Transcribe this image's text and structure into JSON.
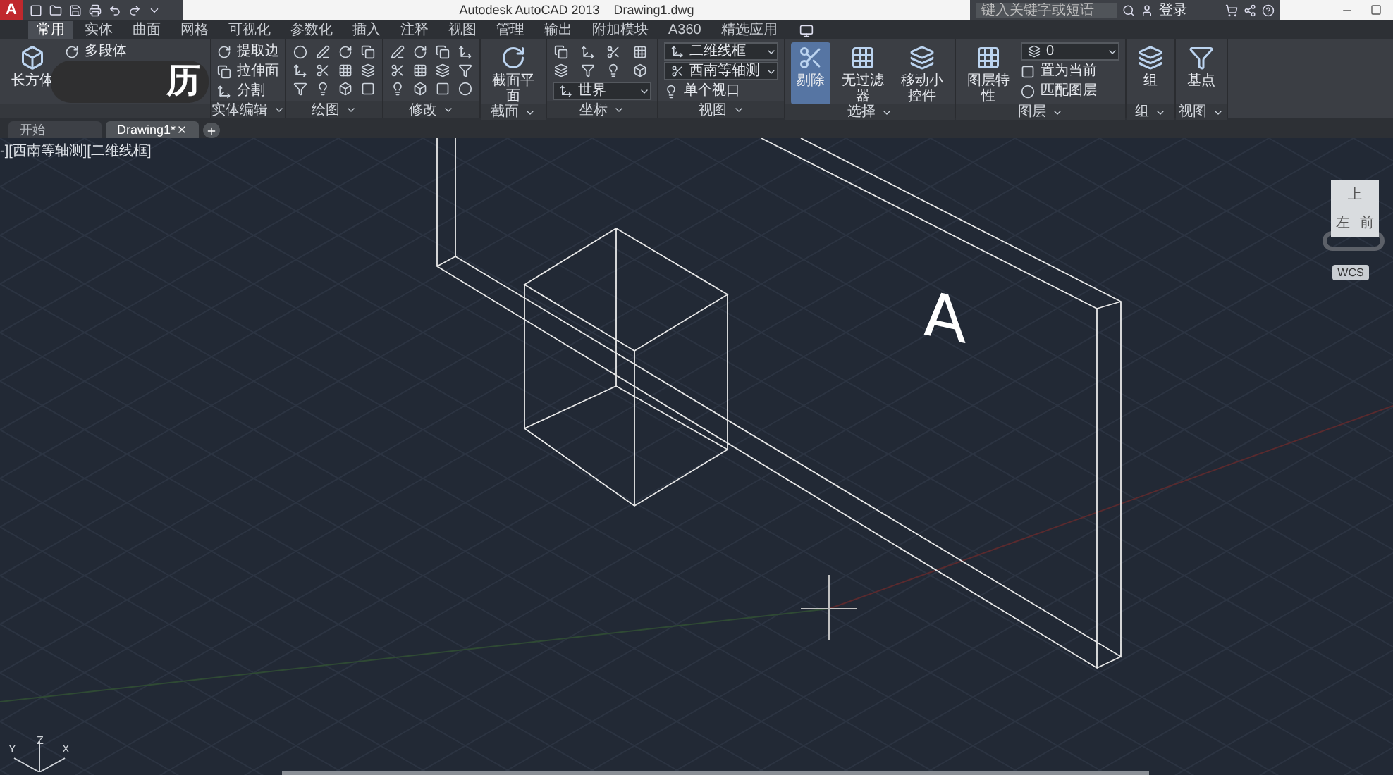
{
  "title_bar": {
    "app_logo": "A",
    "title": "Autodesk AutoCAD 2013    Drawing1.dwg",
    "search": {
      "placeholder": "键入关键字或短语"
    },
    "sign_in": "登录"
  },
  "ribbon_tabs": [
    {
      "label": "常用",
      "selected": true
    },
    {
      "label": "实体",
      "selected": false
    },
    {
      "label": "曲面",
      "selected": false
    },
    {
      "label": "网格",
      "selected": false
    },
    {
      "label": "可视化",
      "selected": false
    },
    {
      "label": "参数化",
      "selected": false
    },
    {
      "label": "插入",
      "selected": false
    },
    {
      "label": "注释",
      "selected": false
    },
    {
      "label": "视图",
      "selected": false
    },
    {
      "label": "管理",
      "selected": false
    },
    {
      "label": "输出",
      "selected": false
    },
    {
      "label": "附加模块",
      "selected": false
    },
    {
      "label": "A360",
      "selected": false
    },
    {
      "label": "精选应用",
      "selected": false
    }
  ],
  "ribbon_panels": [
    {
      "tools": [
        {
          "kind": "large",
          "label": "长方体"
        },
        {
          "kind": "small",
          "label": "多段体"
        }
      ]
    },
    {
      "title": "实体编辑",
      "tools": [
        {
          "kind": "small",
          "label": "提取边"
        },
        {
          "kind": "small",
          "label": "拉伸面"
        },
        {
          "kind": "small",
          "label": "分割"
        }
      ]
    },
    {
      "title": "绘图",
      "tools": [
        {
          "kind": "icon_grid"
        }
      ]
    },
    {
      "title": "修改",
      "tools": [
        {
          "kind": "icon_grid"
        }
      ]
    },
    {
      "title": "截面",
      "tools": [
        {
          "kind": "large",
          "label": "截面平面"
        }
      ]
    },
    {
      "title": "坐标",
      "tools": [
        {
          "kind": "icon_grid"
        },
        {
          "kind": "dropdown",
          "label": "世界"
        }
      ]
    },
    {
      "title": "视图",
      "tools": [
        {
          "kind": "dropdown",
          "label": "二维线框"
        },
        {
          "kind": "dropdown",
          "label": "西南等轴测"
        },
        {
          "kind": "small",
          "label": "单个视口"
        }
      ]
    },
    {
      "title": "选择",
      "tools": [
        {
          "kind": "large",
          "label": "剔除",
          "on": true
        },
        {
          "kind": "large",
          "label": "无过滤器",
          "on": false
        },
        {
          "kind": "large",
          "label": "移动小控件",
          "on": false
        }
      ]
    },
    {
      "title": "图层",
      "tools": [
        {
          "kind": "large",
          "label": "图层特性"
        },
        {
          "kind": "dropdown",
          "label": "0"
        },
        {
          "kind": "small",
          "label": "置为当前"
        },
        {
          "kind": "small",
          "label": "匹配图层"
        }
      ]
    },
    {
      "title": "组",
      "tools": [
        {
          "kind": "large",
          "label": "组"
        }
      ]
    },
    {
      "title": "视图",
      "tools": [
        {
          "kind": "large",
          "label": "基点"
        }
      ]
    }
  ],
  "overlay": {
    "glyph": "历"
  },
  "file_tabs": [
    {
      "label": "开始",
      "selected": false
    },
    {
      "label": "Drawing1*",
      "selected": true
    }
  ],
  "viewport": {
    "label": "-][西南等轴测][二维线框]",
    "model_text": "A",
    "viewcube": {
      "faces": [
        "上",
        "左",
        "前"
      ],
      "wcs": "WCS"
    },
    "ucs_axes": [
      "Z",
      "Y",
      "X"
    ]
  }
}
